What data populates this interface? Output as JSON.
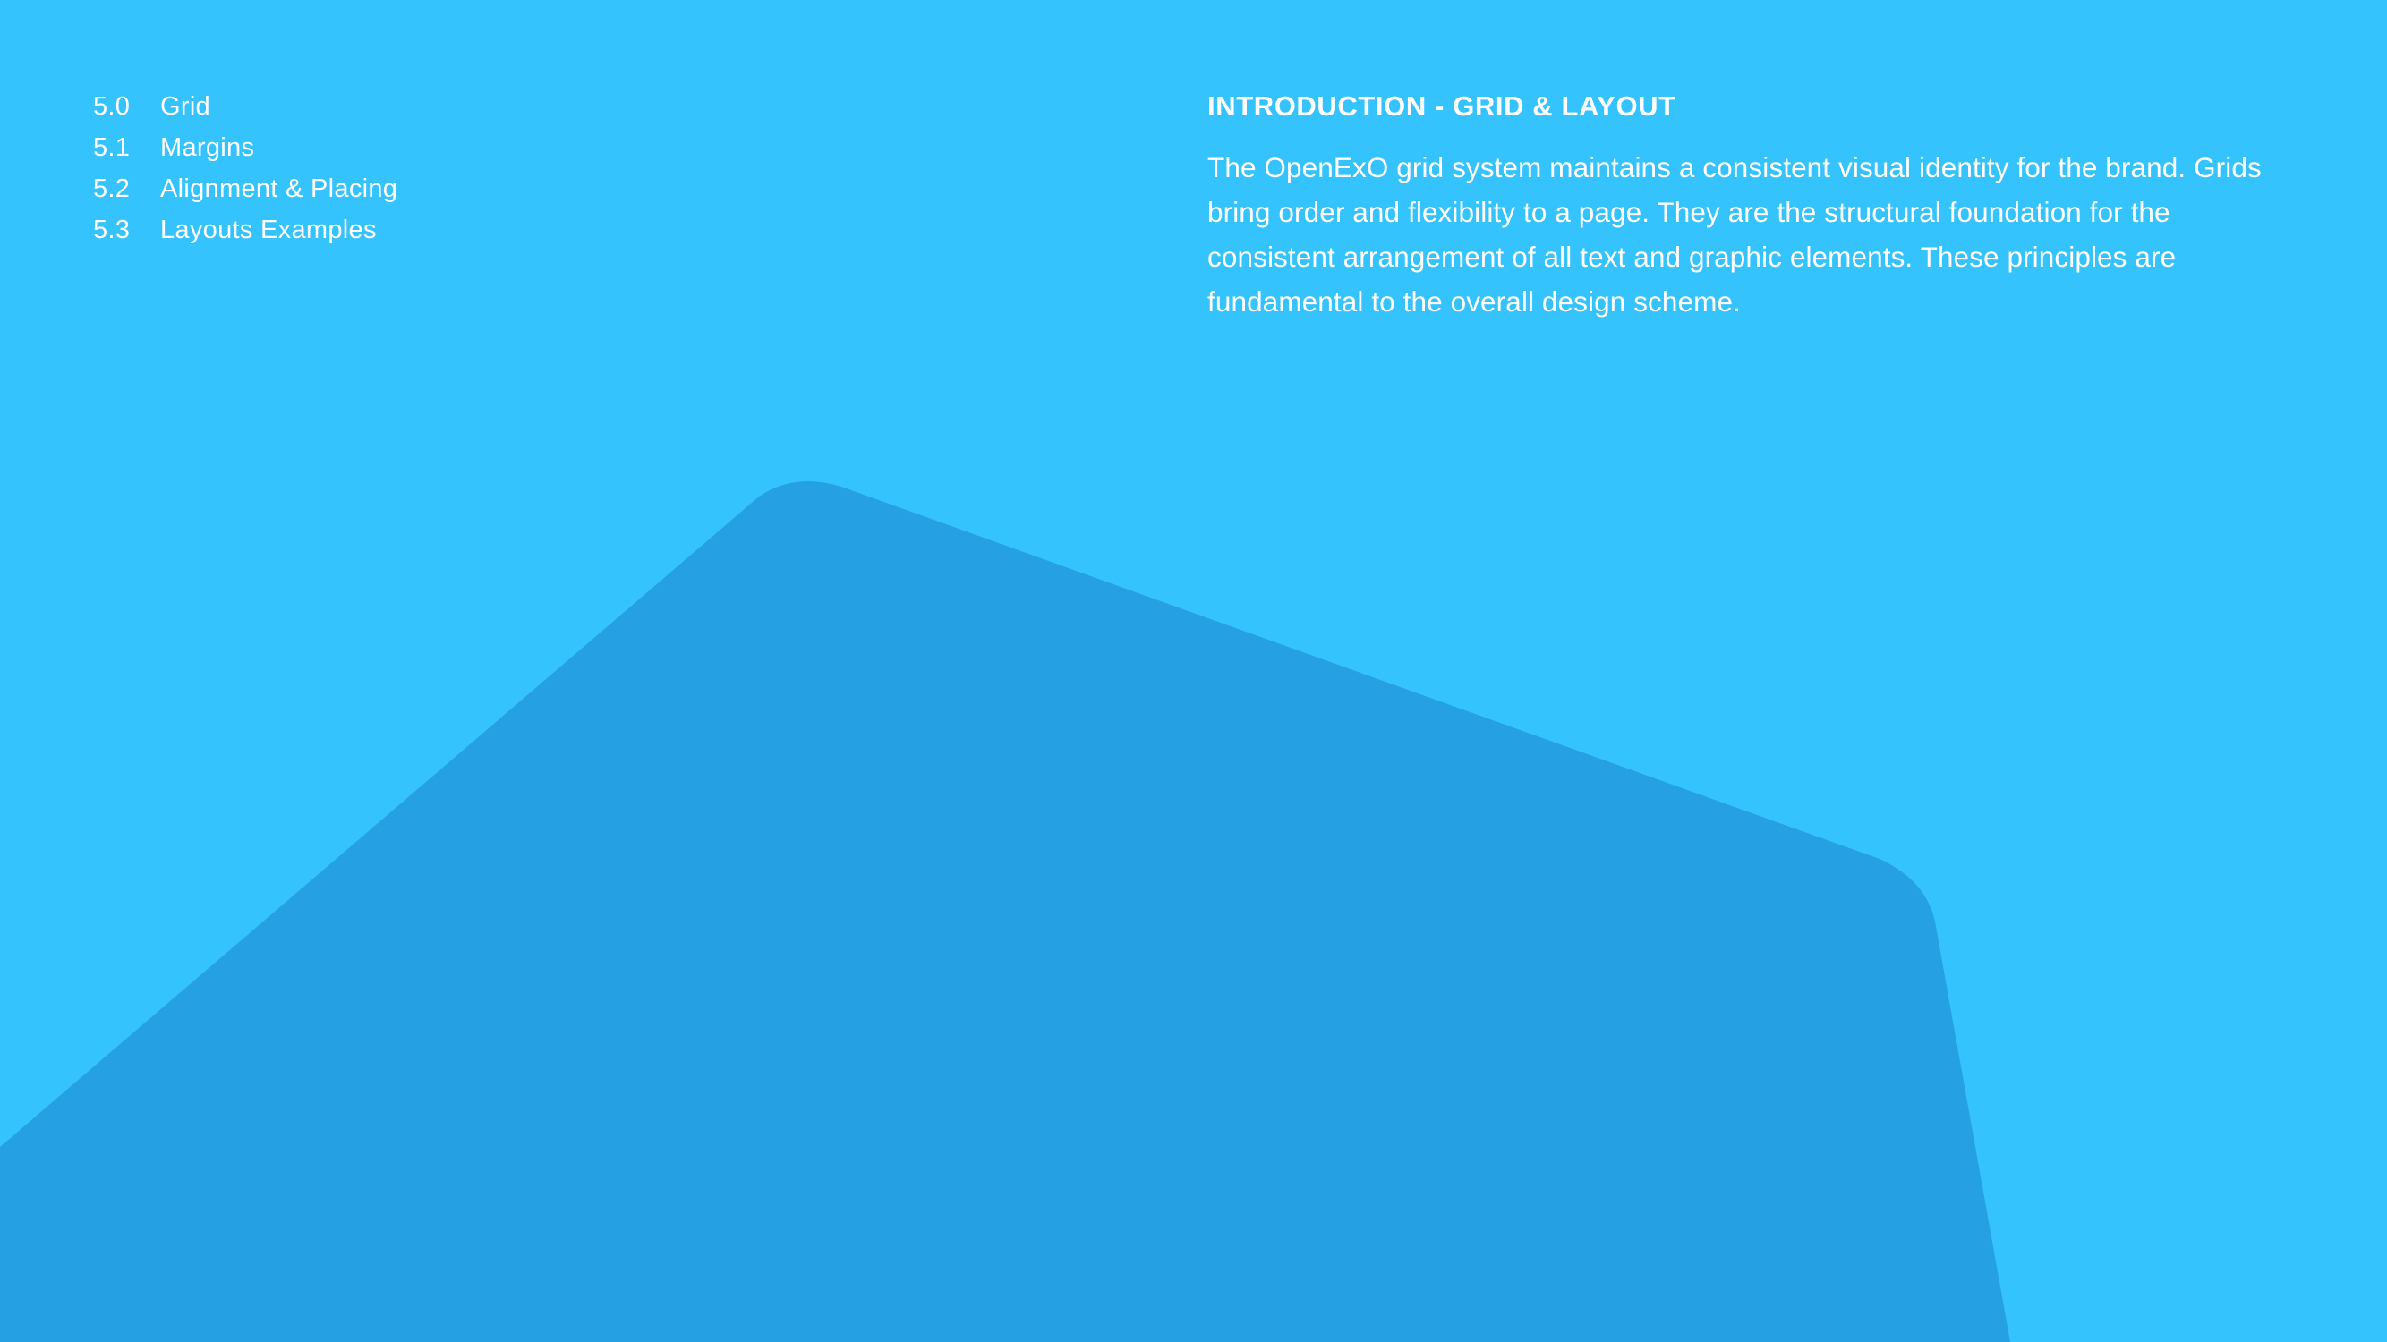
{
  "colors": {
    "background": "#35c3fe",
    "shape": "#25a0e3",
    "text": "#ffffff"
  },
  "toc": {
    "items": [
      {
        "number": "5.0",
        "label": "Grid"
      },
      {
        "number": "5.1",
        "label": "Margins"
      },
      {
        "number": "5.2",
        "label": "Alignment & Placing"
      },
      {
        "number": "5.3",
        "label": "Layouts Examples"
      }
    ]
  },
  "intro": {
    "title": "INTRODUCTION - GRID & LAYOUT",
    "body": "The OpenExO grid system maintains a consistent visual identity for the brand. Grids bring order and flexibility to a page. They are the structural foundation for the consistent arrangement of all text and graphic elements. These principles are fundamental to the overall design scheme."
  }
}
